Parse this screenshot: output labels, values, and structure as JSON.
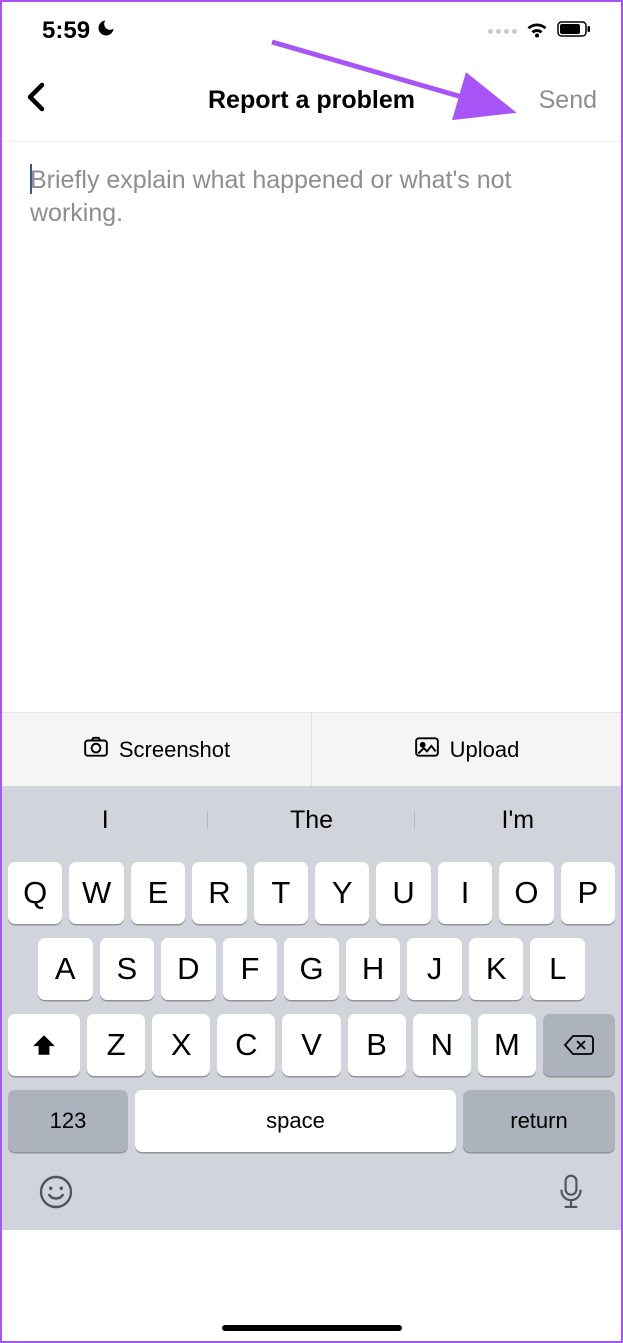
{
  "status": {
    "time": "5:59"
  },
  "header": {
    "title": "Report a problem",
    "send_label": "Send"
  },
  "textarea": {
    "placeholder": "Briefly explain what happened or what's not working."
  },
  "actions": {
    "screenshot_label": "Screenshot",
    "upload_label": "Upload"
  },
  "suggestions": [
    "I",
    "The",
    "I'm"
  ],
  "keyboard": {
    "row1": [
      "Q",
      "W",
      "E",
      "R",
      "T",
      "Y",
      "U",
      "I",
      "O",
      "P"
    ],
    "row2": [
      "A",
      "S",
      "D",
      "F",
      "G",
      "H",
      "J",
      "K",
      "L"
    ],
    "row3": [
      "Z",
      "X",
      "C",
      "V",
      "B",
      "N",
      "M"
    ],
    "num_label": "123",
    "space_label": "space",
    "return_label": "return"
  }
}
